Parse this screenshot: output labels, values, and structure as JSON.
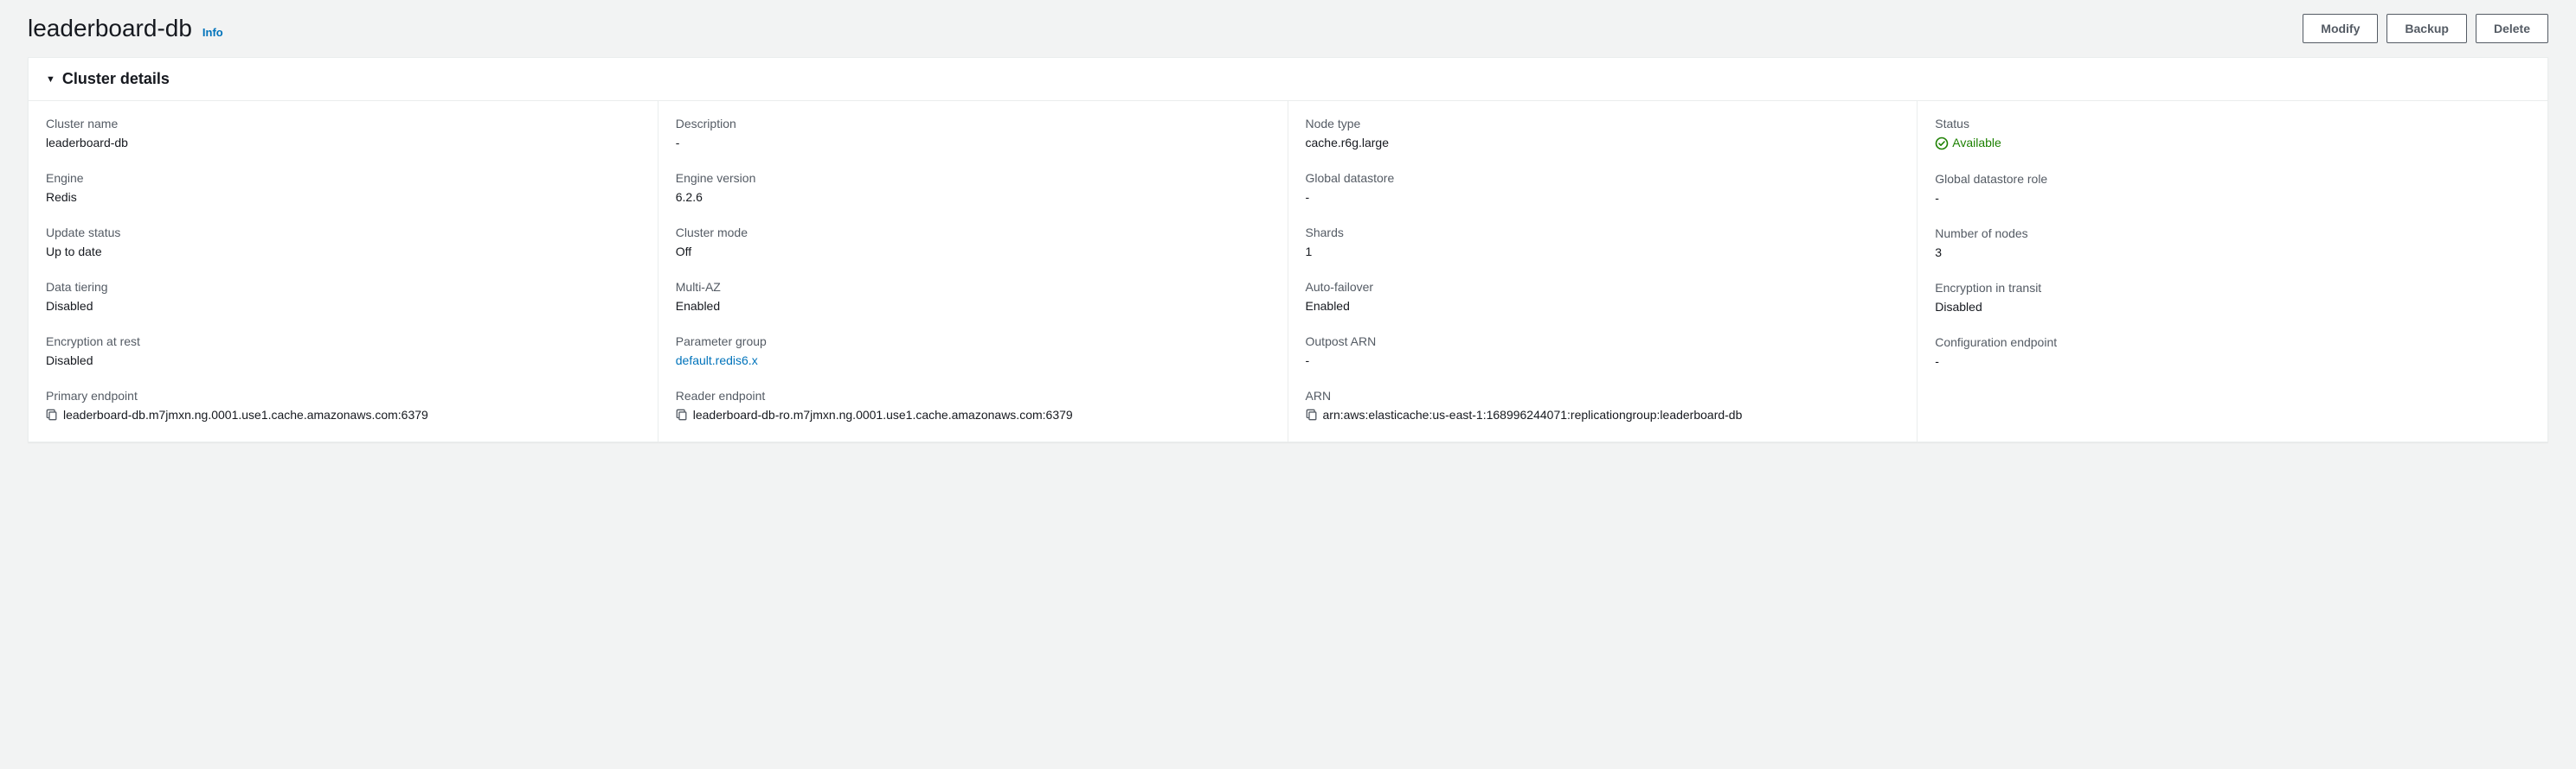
{
  "header": {
    "title": "leaderboard-db",
    "info_label": "Info",
    "buttons": {
      "modify": "Modify",
      "backup": "Backup",
      "delete": "Delete"
    }
  },
  "panel": {
    "title": "Cluster details"
  },
  "details": {
    "col1": {
      "cluster_name": {
        "label": "Cluster name",
        "value": "leaderboard-db"
      },
      "engine": {
        "label": "Engine",
        "value": "Redis"
      },
      "update_status": {
        "label": "Update status",
        "value": "Up to date"
      },
      "data_tiering": {
        "label": "Data tiering",
        "value": "Disabled"
      },
      "encryption_at_rest": {
        "label": "Encryption at rest",
        "value": "Disabled"
      },
      "primary_endpoint": {
        "label": "Primary endpoint",
        "value": "leaderboard-db.m7jmxn.ng.0001.use1.cache.amazonaws.com:6379"
      }
    },
    "col2": {
      "description": {
        "label": "Description",
        "value": "-"
      },
      "engine_version": {
        "label": "Engine version",
        "value": "6.2.6"
      },
      "cluster_mode": {
        "label": "Cluster mode",
        "value": "Off"
      },
      "multi_az": {
        "label": "Multi-AZ",
        "value": "Enabled"
      },
      "parameter_group": {
        "label": "Parameter group",
        "value": "default.redis6.x"
      },
      "reader_endpoint": {
        "label": "Reader endpoint",
        "value": "leaderboard-db-ro.m7jmxn.ng.0001.use1.cache.amazonaws.com:6379"
      }
    },
    "col3": {
      "node_type": {
        "label": "Node type",
        "value": "cache.r6g.large"
      },
      "global_datastore": {
        "label": "Global datastore",
        "value": "-"
      },
      "shards": {
        "label": "Shards",
        "value": "1"
      },
      "auto_failover": {
        "label": "Auto-failover",
        "value": "Enabled"
      },
      "outpost_arn": {
        "label": "Outpost ARN",
        "value": "-"
      },
      "arn": {
        "label": "ARN",
        "value": "arn:aws:elasticache:us-east-1:168996244071:replicationgroup:leaderboard-db"
      }
    },
    "col4": {
      "status": {
        "label": "Status",
        "value": "Available"
      },
      "global_datastore_role": {
        "label": "Global datastore role",
        "value": "-"
      },
      "number_of_nodes": {
        "label": "Number of nodes",
        "value": "3"
      },
      "encryption_in_transit": {
        "label": "Encryption in transit",
        "value": "Disabled"
      },
      "configuration_endpoint": {
        "label": "Configuration endpoint",
        "value": "-"
      }
    }
  }
}
